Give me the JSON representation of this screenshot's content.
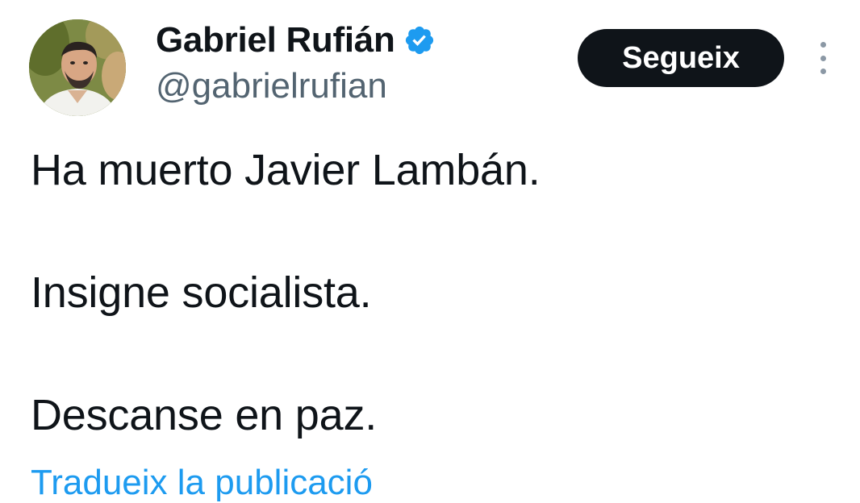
{
  "author": {
    "display_name": "Gabriel Rufián",
    "handle": "@gabrielrufian",
    "verified_icon": "verified-badge-icon",
    "avatar": "profile-photo"
  },
  "actions": {
    "follow_label": "Segueix",
    "more_icon": "more-vertical-icon"
  },
  "tweet": {
    "lines": [
      "Ha muerto Javier Lambán.",
      "Insigne socialista.",
      "Descanse en paz."
    ],
    "translate_label": "Tradueix la publicació"
  },
  "colors": {
    "text": "#0f1419",
    "secondary": "#536471",
    "accent": "#1d9bf0",
    "button_bg": "#0f1419"
  }
}
